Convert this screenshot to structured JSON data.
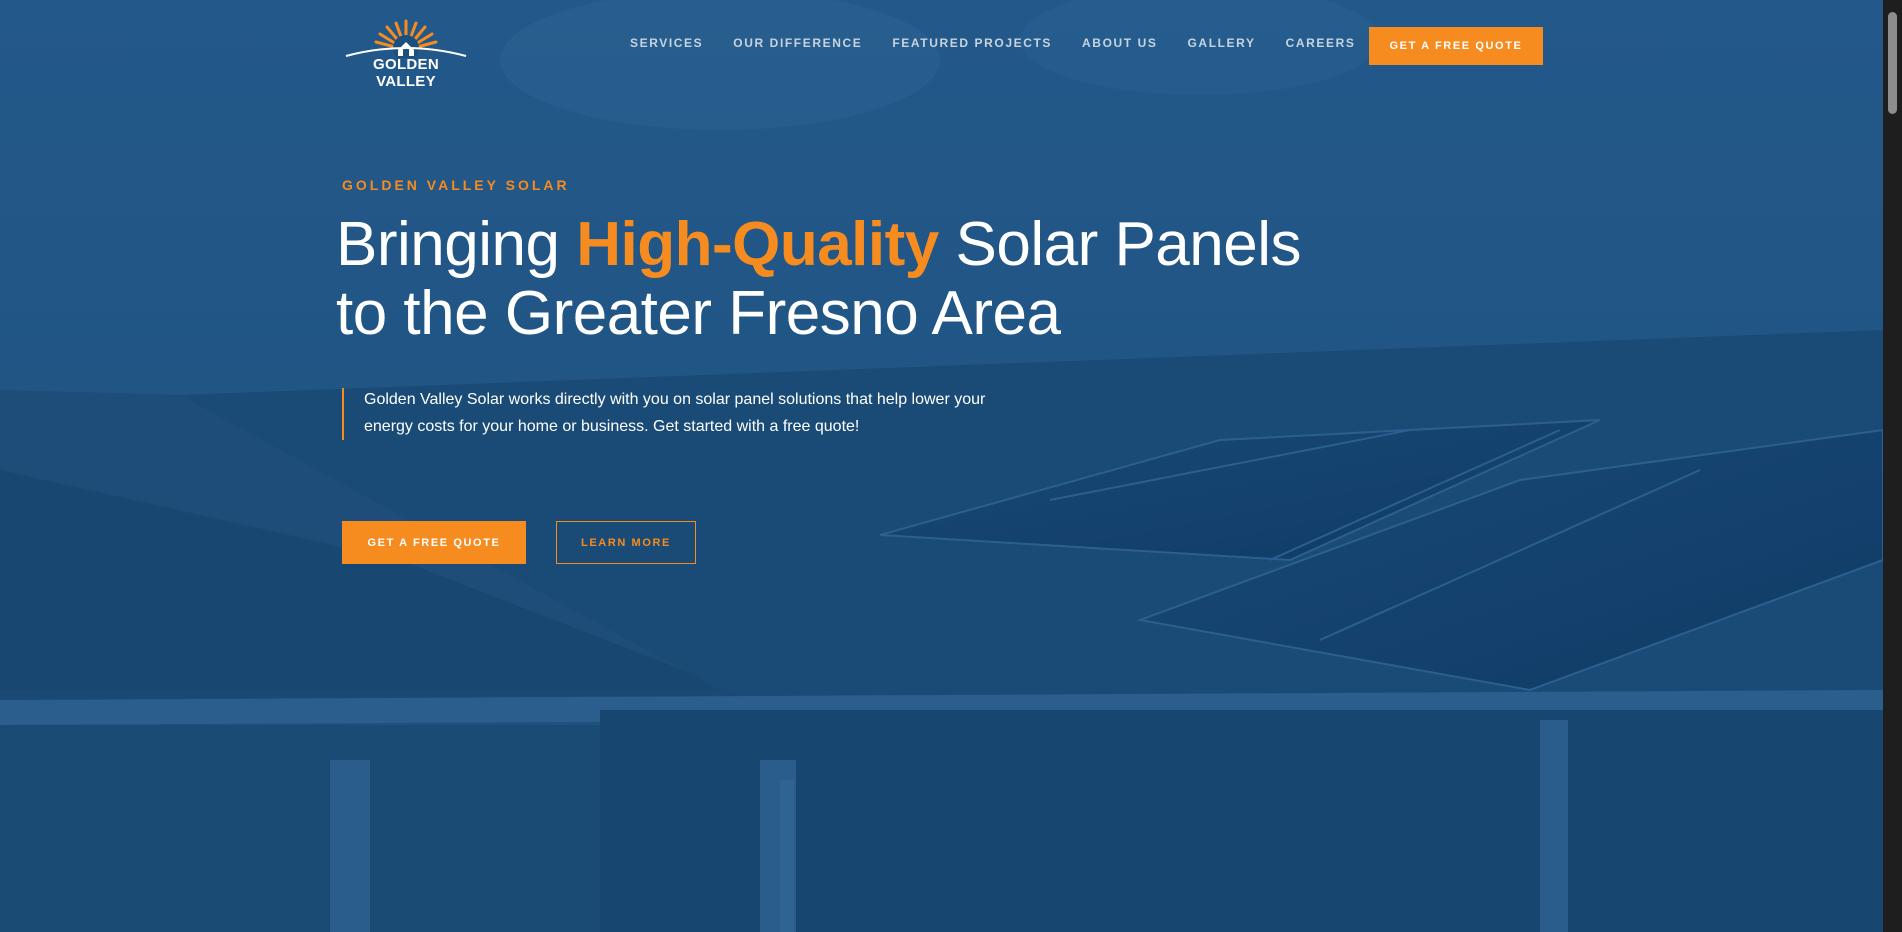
{
  "brand": {
    "name": "GOLDEN VALLEY",
    "logo_icon": "sun-house-icon",
    "accent_color": "#f68c1f",
    "overlay_color": "#1c4f7c"
  },
  "nav": {
    "items": [
      {
        "label": "SERVICES"
      },
      {
        "label": "OUR DIFFERENCE"
      },
      {
        "label": "FEATURED PROJECTS"
      },
      {
        "label": "ABOUT US"
      },
      {
        "label": "GALLERY"
      },
      {
        "label": "CAREERS"
      }
    ],
    "cta_label": "GET A FREE QUOTE"
  },
  "hero": {
    "eyebrow": "GOLDEN VALLEY SOLAR",
    "headline_pre": "Bringing ",
    "headline_highlight": "High-Quality",
    "headline_post": " Solar Panels to the Greater Fresno Area",
    "lead": "Golden Valley Solar works directly with you on solar panel solutions that help lower your energy costs for your home or business. Get started with a free quote!",
    "primary_button": "GET A FREE QUOTE",
    "secondary_button": "LEARN MORE",
    "background_image": "solar-roof-photo"
  }
}
